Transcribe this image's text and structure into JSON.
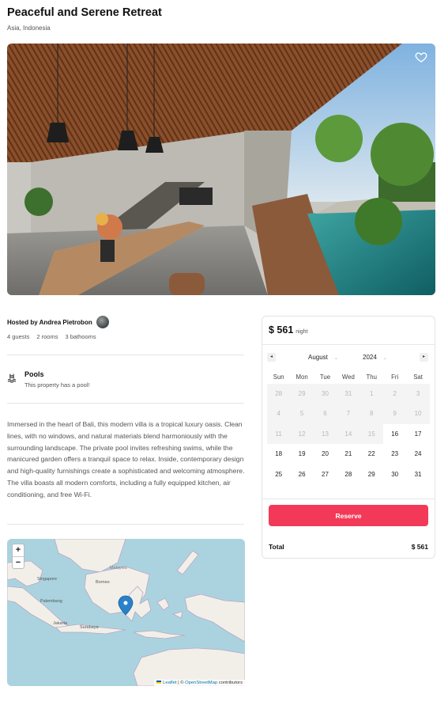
{
  "listing": {
    "title": "Peaceful and Serene Retreat",
    "location": "Asia, Indonesia"
  },
  "host": {
    "label": "Hosted by Andrea Pietrobon",
    "facts": [
      "4 guests",
      "2 rooms",
      "3 bathooms"
    ]
  },
  "amenity": {
    "icon": "pool-icon",
    "title": "Pools",
    "description": "This property has a pool!"
  },
  "description": "Immersed in the heart of Bali, this modern villa is a tropical luxury oasis. Clean lines, with no windows, and natural materials blend harmoniously with the surrounding landscape. The private pool invites refreshing swims, while the manicured garden offers a tranquil space to relax. Inside, contemporary design and high-quality furnishings create a sophisticated and welcoming atmosphere. The villa boasts all modern comforts, including a fully equipped kitchen, air conditioning, and free Wi-Fi.",
  "map": {
    "zoom_in": "+",
    "zoom_out": "−",
    "labels": [
      "Malaysia",
      "Singapore",
      "Borneo",
      "Palembang",
      "Jakarta",
      "Surabaya"
    ],
    "attribution_leaflet": "Leaflet",
    "attribution_sep": " | © ",
    "attribution_osm": "OpenStreetMap",
    "attribution_tail": " contributors"
  },
  "booking": {
    "price": "$ 561",
    "price_unit": "night",
    "calendar": {
      "month": "August",
      "year": "2024",
      "prev_icon": "◂",
      "next_icon": "▸",
      "weekdays": [
        "Sun",
        "Mon",
        "Tue",
        "Wed",
        "Thu",
        "Fri",
        "Sat"
      ],
      "weeks": [
        [
          "28",
          "29",
          "30",
          "31",
          "1",
          "2",
          "3"
        ],
        [
          "4",
          "5",
          "6",
          "7",
          "8",
          "9",
          "10"
        ],
        [
          "11",
          "12",
          "13",
          "14",
          "15",
          "16",
          "17"
        ],
        [
          "18",
          "19",
          "20",
          "21",
          "22",
          "23",
          "24"
        ],
        [
          "25",
          "26",
          "27",
          "28",
          "29",
          "30",
          "31"
        ]
      ],
      "selected": "13",
      "disabled_count": 19
    },
    "reserve_label": "Reserve",
    "total_label": "Total",
    "total_value": "$ 561"
  },
  "colors": {
    "accent": "#f23a58",
    "selected_day": "#222222"
  }
}
